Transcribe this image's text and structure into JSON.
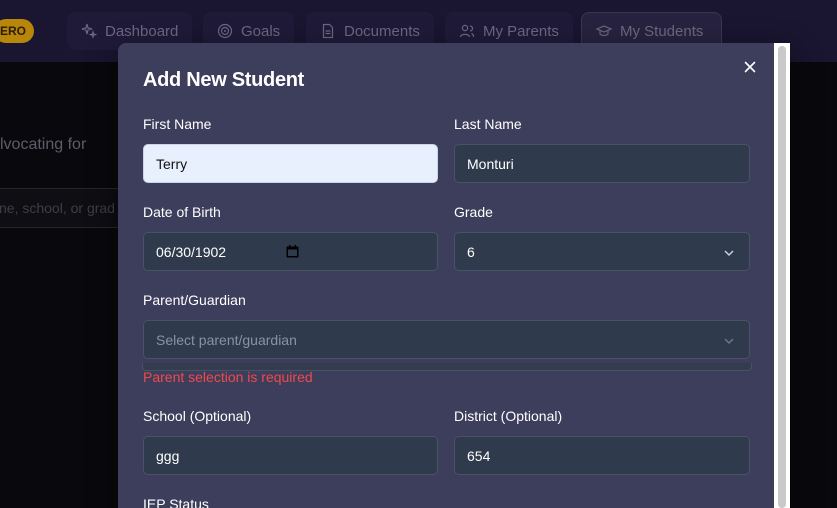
{
  "nav": {
    "hero_badge": "ERO",
    "tabs": [
      {
        "label": "Dashboard",
        "icon": "sparkle-icon"
      },
      {
        "label": "Goals",
        "icon": "target-icon"
      },
      {
        "label": "Documents",
        "icon": "document-icon"
      },
      {
        "label": "My Parents",
        "icon": "users-icon"
      },
      {
        "label": "My Students",
        "icon": "graduation-cap-icon"
      }
    ]
  },
  "background": {
    "advocating_text": "lvocating for",
    "search_placeholder": "ne, school, or grad"
  },
  "modal": {
    "title": "Add New Student",
    "close_icon": "close-icon",
    "first_name": {
      "label": "First Name",
      "value": "Terry"
    },
    "last_name": {
      "label": "Last Name",
      "value": "Monturi"
    },
    "dob": {
      "label": "Date of Birth",
      "value": "06/30/1902"
    },
    "grade": {
      "label": "Grade",
      "value": "6"
    },
    "parent": {
      "label": "Parent/Guardian",
      "placeholder": "Select parent/guardian",
      "error": "Parent selection is required"
    },
    "school": {
      "label": "School (Optional)",
      "value": "ggg"
    },
    "district": {
      "label": "District (Optional)",
      "value": "654"
    },
    "iep_status": {
      "label": "IEP Status"
    }
  }
}
